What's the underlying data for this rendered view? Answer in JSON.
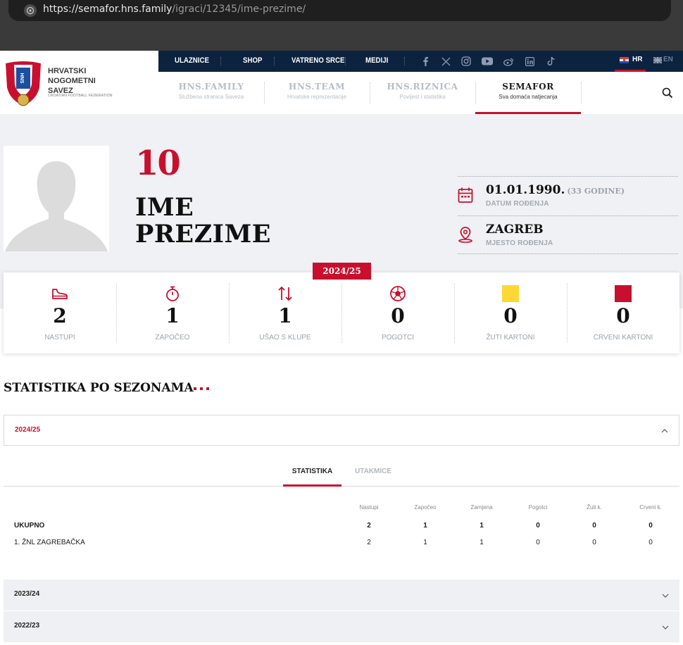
{
  "browser": {
    "url_host": "https://semafor.hns.family",
    "url_path": "/igraci/12345/ime-prezime/"
  },
  "logo": {
    "line1": "HRVATSKI",
    "line2": "NOGOMETNI",
    "line3": "SAVEZ",
    "subtitle": "CROATIAN FOOTBALL FEDERATION",
    "shield_text": "HNS"
  },
  "topnav": {
    "items": [
      "ULAZNICE",
      "SHOP",
      "VATRENO SRCE",
      "MEDIJI"
    ],
    "lang_hr": "HR",
    "lang_en": "EN"
  },
  "mainnav": [
    {
      "title": "HNS.FAMILY",
      "sub": "Službena stranica Saveza"
    },
    {
      "title": "HNS.TEAM",
      "sub": "Hrvatske reprezentacije"
    },
    {
      "title": "HNS.RIZNICA",
      "sub": "Povijest i statistika"
    },
    {
      "title": "SEMAFOR",
      "sub": "Sva domaća natjecanja"
    }
  ],
  "player": {
    "number": "10",
    "first_name": "IME",
    "last_name": "PREZIME",
    "birth_date": "01.01.1990.",
    "age": "(33 GODINE)",
    "birth_date_label": "DATUM ROĐENJA",
    "birth_place": "ZAGREB",
    "birth_place_label": "MJESTO ROĐENJA"
  },
  "season_badge": "2024/25",
  "summary_stats": [
    {
      "icon": "boot-icon",
      "value": "2",
      "label": "NASTUPI"
    },
    {
      "icon": "stopwatch-icon",
      "value": "1",
      "label": "ZAPOČEO"
    },
    {
      "icon": "substitution-icon",
      "value": "1",
      "label": "UŠAO S KLUPE"
    },
    {
      "icon": "ball-icon",
      "value": "0",
      "label": "POGOTCI"
    },
    {
      "icon": "yellow-card-icon",
      "value": "0",
      "label": "ŽUTI KARTONI"
    },
    {
      "icon": "red-card-icon",
      "value": "0",
      "label": "CRVENI KARTONI"
    }
  ],
  "colors": {
    "accent": "#c8102e",
    "navy": "#0c2340",
    "yellow_card": "#fdd835"
  },
  "seasons_section": {
    "title": "STATISTIKA PO SEZONAMA",
    "open_season": "2024/25",
    "tabs": [
      "STATISTIKA",
      "UTAKMICE"
    ],
    "columns": [
      "Nastupi",
      "Započeo",
      "Zamjena",
      "Pogotci",
      "Žuti k.",
      "Crveni k."
    ],
    "rows": [
      {
        "name": "UKUPNO",
        "values": [
          "2",
          "1",
          "1",
          "0",
          "0",
          "0"
        ]
      },
      {
        "name": "1. ŽNL ZAGREBAČKA",
        "values": [
          "2",
          "1",
          "1",
          "0",
          "0",
          "0"
        ]
      }
    ],
    "closed_seasons": [
      "2023/24",
      "2022/23"
    ]
  }
}
